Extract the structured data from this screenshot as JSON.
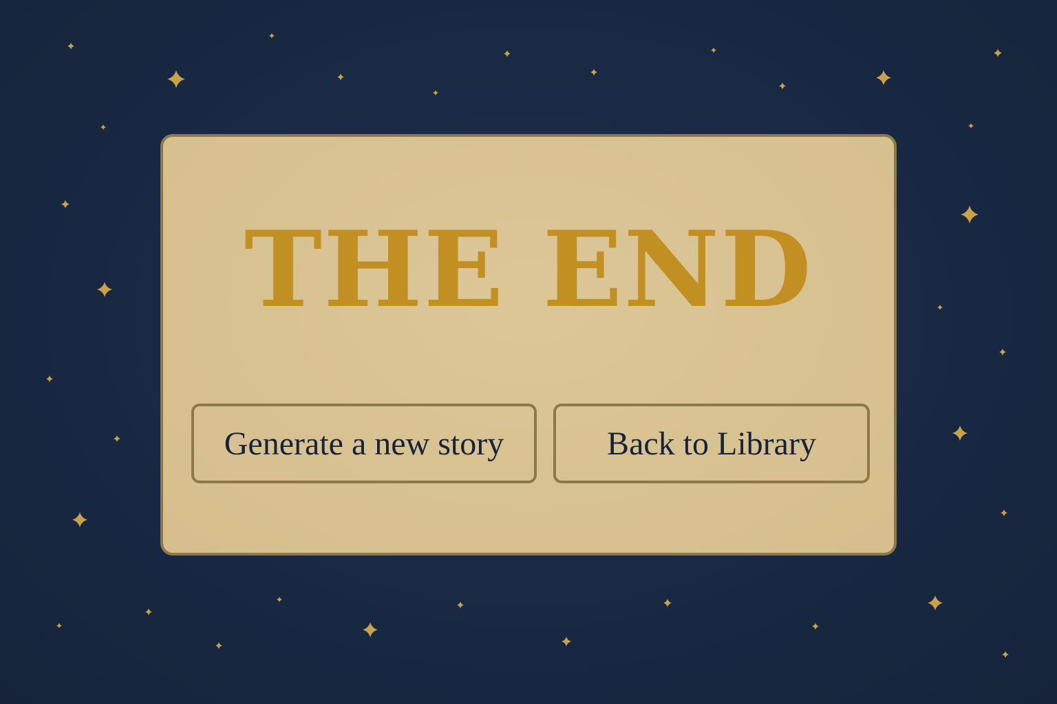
{
  "title": "THE END",
  "buttons": {
    "generate_label": "Generate a new story",
    "library_label": "Back to Library"
  },
  "colors": {
    "background": "#1a2a44",
    "card": "#d9c293",
    "card_border": "#8b7a48",
    "title": "#c28f23",
    "button_text": "#17233a",
    "star": "#c9a24a"
  },
  "decor": {
    "star_icon": "four-point-sparkle-icon"
  }
}
